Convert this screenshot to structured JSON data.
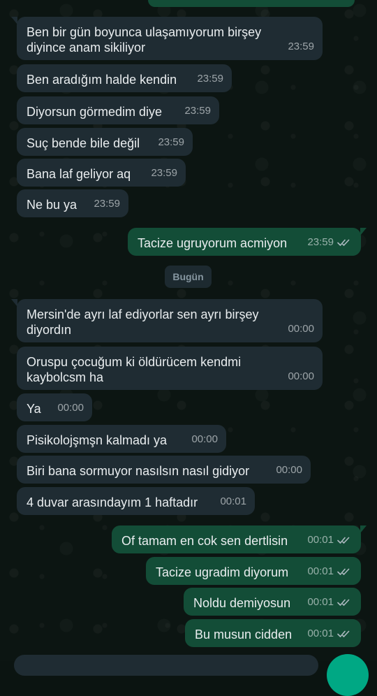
{
  "chat": {
    "messages": [
      {
        "dir": "in",
        "text": "Ben bir gün boyunca ulaşamıyorum birşey\ndiyince anam sikiliyor",
        "time": "23:59"
      },
      {
        "dir": "in",
        "text": "Ben aradığım halde kendin",
        "time": "23:59"
      },
      {
        "dir": "in",
        "text": "Diyorsun görmedim diye",
        "time": "23:59"
      },
      {
        "dir": "in",
        "text": "Suç bende bile değil",
        "time": "23:59"
      },
      {
        "dir": "in",
        "text": "Bana laf geliyor aq",
        "time": "23:59"
      },
      {
        "dir": "in",
        "text": "Ne bu ya",
        "time": "23:59"
      },
      {
        "dir": "out",
        "text": "Tacize ugruyorum acmiyon",
        "time": "23:59",
        "status": "read"
      },
      {
        "dir": "in",
        "text": "Mersin'de ayrı laf ediyorlar sen ayrı birşey\ndiyordın",
        "time": "00:00"
      },
      {
        "dir": "in",
        "text": "Oruspu çocuğum ki öldürücem kendmi\nkaybolcsm ha",
        "time": "00:00"
      },
      {
        "dir": "in",
        "text": "Ya",
        "time": "00:00"
      },
      {
        "dir": "in",
        "text": "Pisikolojşmşn kalmadı ya",
        "time": "00:00"
      },
      {
        "dir": "in",
        "text": "Biri bana sormuyor nasılsın nasıl gidiyor",
        "time": "00:00"
      },
      {
        "dir": "in",
        "text": "4 duvar arasındayım 1 haftadır",
        "time": "00:01"
      },
      {
        "dir": "out",
        "text": "Of tamam en cok sen dertlisin",
        "time": "00:01",
        "status": "read"
      },
      {
        "dir": "out",
        "text": "Tacize ugradim diyorum",
        "time": "00:01",
        "status": "read"
      },
      {
        "dir": "out",
        "text": "Noldu demiyosun",
        "time": "00:01",
        "status": "read"
      },
      {
        "dir": "out",
        "text": "Bu musun cidden",
        "time": "00:01",
        "status": "read"
      }
    ],
    "date_separator": "Bugün"
  },
  "icons": {
    "read_receipt": "double-check-icon",
    "send": "mic-icon"
  },
  "colors": {
    "incoming_bubble": "#1f2c33",
    "outgoing_bubble": "#134d37",
    "wallpaper": "#0c1512",
    "text": "#e9edef",
    "meta": "#8696a0",
    "accent": "#00a884"
  }
}
